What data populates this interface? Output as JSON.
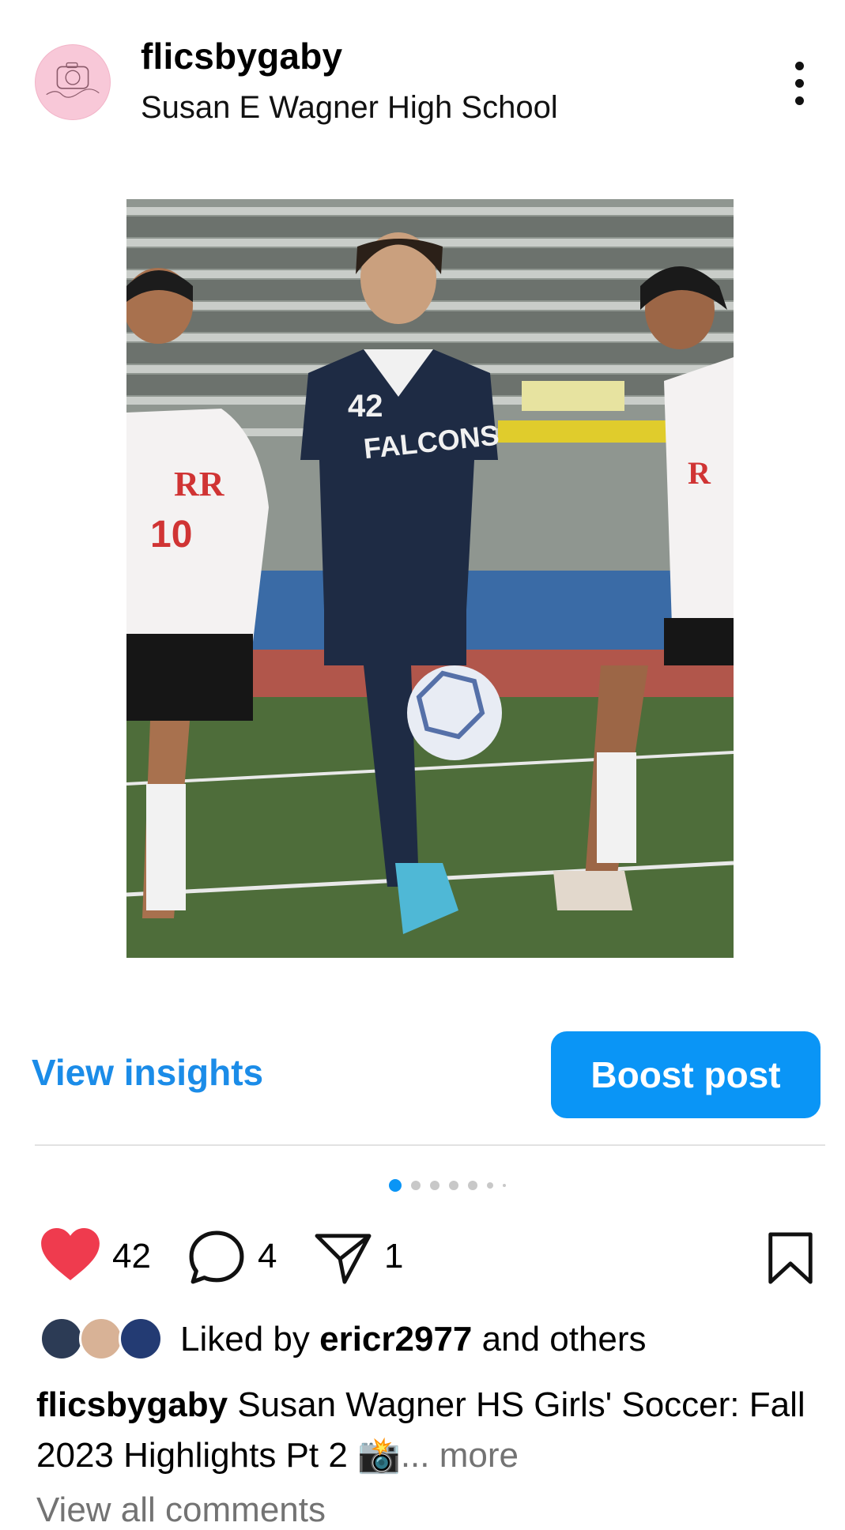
{
  "post": {
    "username": "flicsbygaby",
    "location": "Susan E Wagner High School"
  },
  "photo": {
    "jersey_number": "42",
    "jersey_text": "FALCONS",
    "left_player_number": "10",
    "left_player_logo": "RR",
    "right_player_logo": "R"
  },
  "actions": {
    "view_insights": "View insights",
    "boost_post": "Boost post",
    "like_count": "42",
    "comment_count": "4",
    "share_count": "1"
  },
  "carousel": {
    "total": 7,
    "active": 1
  },
  "likes": {
    "prefix": "Liked by ",
    "user": "ericr2977",
    "suffix": " and others"
  },
  "caption": {
    "author": "flicsbygaby",
    "text": " Susan Wagner HS Girls' Soccer: Fall 2023 Highlights Pt 2 📸",
    "more": "... more"
  },
  "comments": {
    "view_all": "View all comments"
  },
  "colors": {
    "accent": "#0a95f6",
    "link": "#1b8ce8",
    "like": "#ef3b4e",
    "muted": "#737373"
  }
}
